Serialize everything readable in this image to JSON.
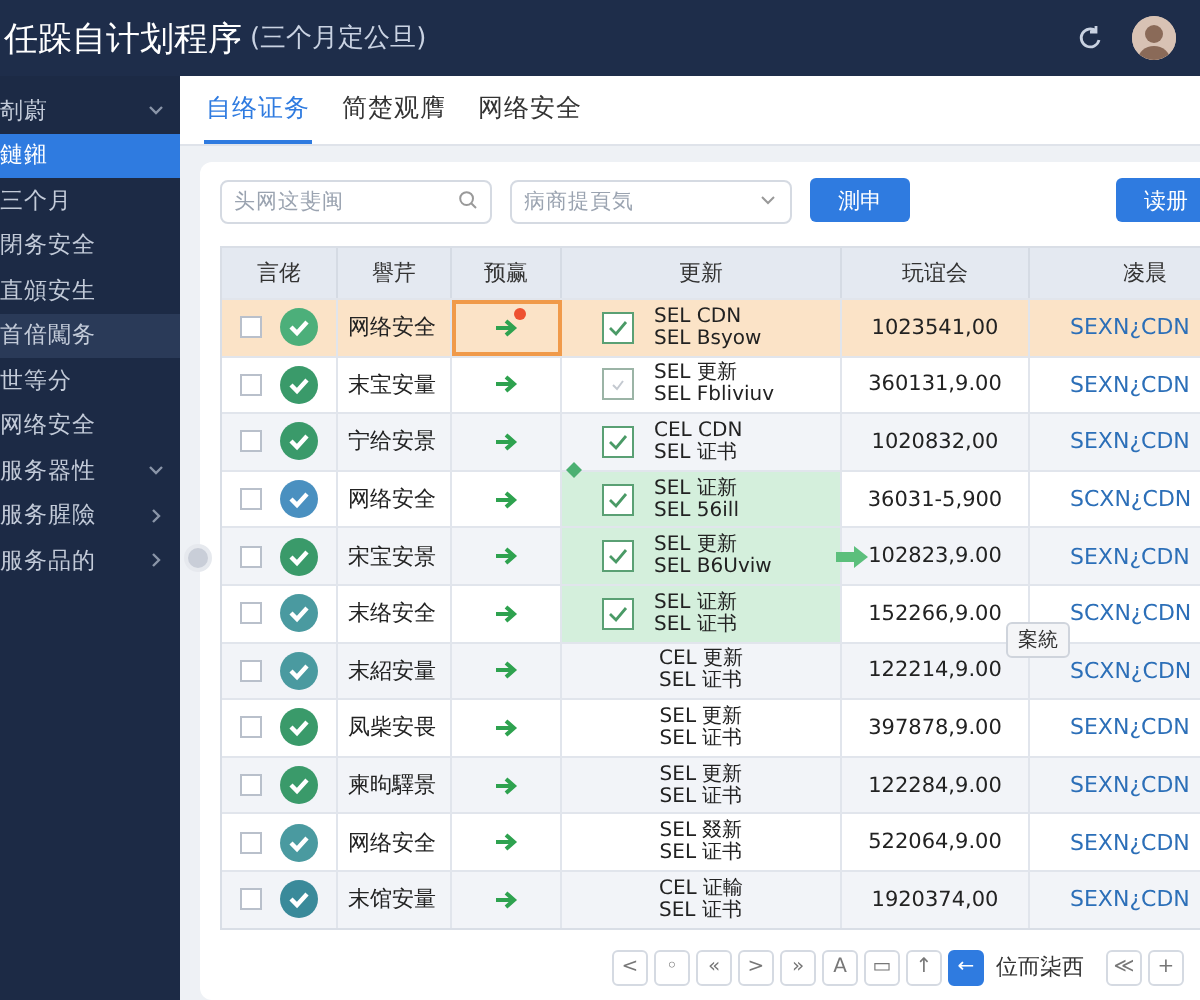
{
  "header": {
    "title": "任跺自计划程序",
    "subtitle": "(三个月定公旦)"
  },
  "sidebar": {
    "items": [
      {
        "label": "剞蔚",
        "selected": false,
        "expanded": true
      },
      {
        "label": "鏈鎺",
        "selected": true
      },
      {
        "label": "三个月",
        "selected": false
      },
      {
        "label": "閉务安全",
        "selected": false
      },
      {
        "label": "直頒安生",
        "selected": false
      },
      {
        "label": "首偣闖务",
        "selected": false
      },
      {
        "label": "世等分",
        "selected": false
      },
      {
        "label": "网络安全",
        "selected": false
      },
      {
        "label": "服务器性",
        "selected": false,
        "expanded": true
      },
      {
        "label": "服务腥險",
        "selected": false,
        "expanded": false
      },
      {
        "label": "服务品的",
        "selected": false,
        "expanded": false
      }
    ]
  },
  "tabs": [
    {
      "label": "自络证务",
      "selected": true
    },
    {
      "label": "简楚观膺",
      "selected": false
    },
    {
      "label": "网络安全",
      "selected": false
    }
  ],
  "search": {
    "placeholder": "头网这斐闽"
  },
  "dropdown": {
    "placeholder": "病商提頁気"
  },
  "buttons": [
    "測申",
    "读册"
  ],
  "table": {
    "columns": [
      "言佬",
      "譽芹",
      "预赢",
      "更新",
      "玩谊会",
      "凌晨"
    ],
    "rows": [
      {
        "selected": true,
        "checked": false,
        "color": "#4caf7a",
        "name": "网络安全",
        "alert": true,
        "kind": "check",
        "update_checked": true,
        "update": [
          "SEL CDN",
          "SEL Bsyow"
        ],
        "highlighted": false,
        "amount": "1023541,00",
        "arrow": false,
        "link": "SEXN¿CDN"
      },
      {
        "selected": false,
        "checked": false,
        "color": "#3a9a6a",
        "name": "末宝安量",
        "alert": false,
        "kind": "check",
        "update_checked": false,
        "update": [
          "SEL 更新",
          "SEL Fbliviuv"
        ],
        "highlighted": false,
        "amount": "360131,9.00",
        "arrow": false,
        "link": "SEXN¿CDN"
      },
      {
        "selected": false,
        "checked": false,
        "color": "#3a9a6a",
        "name": "宁给安景",
        "alert": false,
        "kind": "check",
        "update_checked": true,
        "update": [
          "CEL CDN",
          "SEL 证书"
        ],
        "highlighted": false,
        "amount": "1020832,00",
        "arrow": false,
        "link": "SEXN¿CDN"
      },
      {
        "selected": false,
        "checked": false,
        "color": "#4a90c0",
        "name": "网络安全",
        "alert": false,
        "kind": "check",
        "update_checked": true,
        "update": [
          "SEL 证新",
          "SEL 56ill"
        ],
        "highlighted": true,
        "amount": "36031-5,900",
        "arrow": false,
        "link": "SCXN¿CDN"
      },
      {
        "selected": false,
        "checked": false,
        "color": "#3a9a6a",
        "name": "宋宝安景",
        "alert": false,
        "kind": "check",
        "update_checked": true,
        "update": [
          "SEL 更新",
          "SEL B6Uviw"
        ],
        "highlighted": true,
        "amount": "102823,9.00",
        "arrow": true,
        "link": "SEXN¿CDN"
      },
      {
        "selected": false,
        "checked": false,
        "color": "#4a9aa0",
        "name": "末络安全",
        "alert": false,
        "kind": "check",
        "update_checked": true,
        "update": [
          "SEL 证新",
          "SEL 证书"
        ],
        "highlighted": true,
        "amount": "152266,9.00",
        "arrow": false,
        "tooltip": "案統",
        "link": "SCXN¿CDN"
      },
      {
        "selected": false,
        "checked": false,
        "color": "#4a9aa0",
        "name": "末紹安量",
        "alert": false,
        "kind": "plain",
        "update": [
          "CEL 更新",
          "SEL 证书"
        ],
        "highlighted": false,
        "amount": "122214,9.00",
        "arrow": false,
        "link": "SCXN¿CDN"
      },
      {
        "selected": false,
        "checked": false,
        "color": "#3a9a6a",
        "name": "凤柴安畏",
        "alert": false,
        "kind": "plain",
        "update": [
          "SEL 更新",
          "SEL 证书"
        ],
        "highlighted": false,
        "amount": "397878,9.00",
        "arrow": false,
        "link": "SEXN¿CDN"
      },
      {
        "selected": false,
        "checked": false,
        "color": "#3a9a6a",
        "name": "柬昫驛景",
        "alert": false,
        "kind": "plain",
        "update": [
          "SEL 更新",
          "SEL 证书"
        ],
        "highlighted": false,
        "amount": "122284,9.00",
        "arrow": false,
        "link": "SEXN¿CDN"
      },
      {
        "selected": false,
        "checked": false,
        "color": "#4a9aa0",
        "name": "网络安全",
        "alert": false,
        "kind": "plain",
        "update": [
          "SEL 叕新",
          "SEL 证书"
        ],
        "highlighted": false,
        "amount": "522064,9.00",
        "arrow": false,
        "link": "SEXN¿CDN"
      },
      {
        "selected": false,
        "checked": false,
        "color": "#3a8a9a",
        "name": "末馆安量",
        "alert": false,
        "kind": "plain",
        "update": [
          "CEL 证輸",
          "SEL 证书"
        ],
        "highlighted": false,
        "amount": "1920374,00",
        "arrow": false,
        "link": "SEXN¿CDN"
      }
    ]
  },
  "pager": {
    "buttons": [
      {
        "label": "<",
        "selected": false
      },
      {
        "label": "◦",
        "selected": false
      },
      {
        "label": "«",
        "selected": false
      },
      {
        "label": ">",
        "selected": false
      },
      {
        "label": "»",
        "selected": false
      },
      {
        "label": "A",
        "selected": false
      },
      {
        "label": "▭",
        "selected": false
      },
      {
        "label": "↑",
        "selected": false
      },
      {
        "label": "←",
        "selected": true
      }
    ],
    "text": "位而柒西",
    "extra": [
      "≪",
      "+"
    ]
  }
}
